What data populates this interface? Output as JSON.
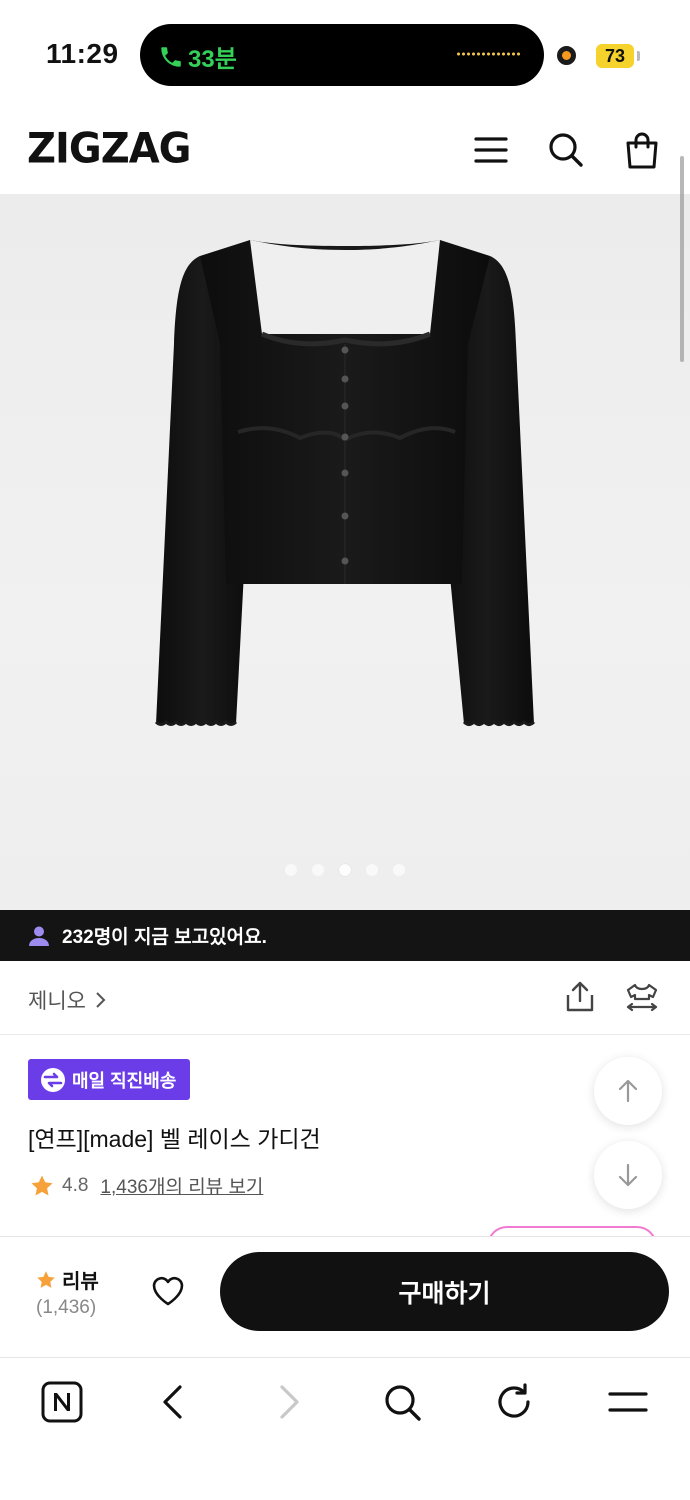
{
  "status": {
    "time": "11:29",
    "call_duration": "33분",
    "battery": "73"
  },
  "header": {
    "logo": "ZIGZAG",
    "icons": [
      "menu-icon",
      "search-icon",
      "shopping-bag-icon"
    ]
  },
  "hero": {
    "slide_count": 5,
    "active_slide": 3,
    "product_image": "black-lace-cardigan"
  },
  "viewers": {
    "text": "232명이 지금 보고있어요."
  },
  "shop": {
    "name": "제니오",
    "icons": [
      "share-icon",
      "try-on-icon"
    ]
  },
  "product": {
    "badge": "매일 직진배송",
    "title": "[연프][made] 벨 레이스 가디건",
    "rating": "4.8",
    "review_link": "1,436개의 리뷰 보기"
  },
  "buy_bar": {
    "review_label": "리뷰",
    "review_count": "(1,436)",
    "buy_label": "구매하기"
  },
  "browser": {
    "icons": [
      "naver-icon",
      "back-icon",
      "forward-icon",
      "search-icon",
      "reload-icon",
      "menu-icon"
    ]
  },
  "colors": {
    "accent_purple": "#6b3de8",
    "star": "#f7a13a",
    "call_green": "#34d058",
    "battery_yellow": "#f5d22c"
  }
}
